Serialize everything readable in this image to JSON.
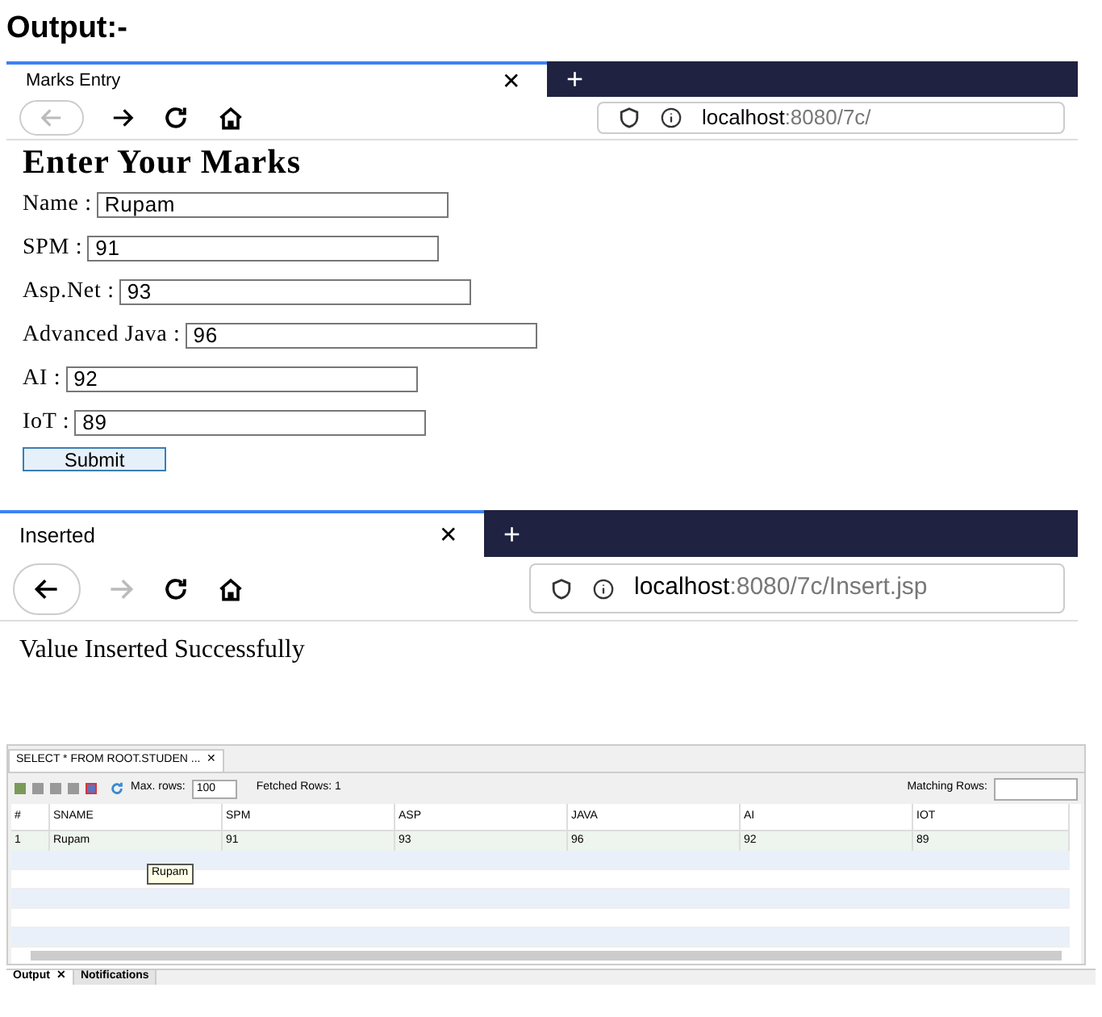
{
  "heading": "Output:-",
  "browser_1": {
    "tab": {
      "title": "Marks Entry",
      "close": "✕",
      "new_tab": "+"
    },
    "back_enabled": false,
    "forward_enabled": true,
    "url": {
      "host": "localhost",
      "path": ":8080/7c/"
    },
    "page": {
      "title": "Enter Your Marks",
      "fields": [
        {
          "label": "Name :",
          "value": "Rupam"
        },
        {
          "label": "SPM :",
          "value": "91"
        },
        {
          "label": "Asp.Net :",
          "value": "93"
        },
        {
          "label": "Advanced Java :",
          "value": "96"
        },
        {
          "label": "AI :",
          "value": "92"
        },
        {
          "label": "IoT :",
          "value": "89"
        }
      ],
      "submit": "Submit"
    }
  },
  "browser_2": {
    "tab": {
      "title": "Inserted",
      "close": "✕",
      "new_tab": "+"
    },
    "back_enabled": true,
    "forward_enabled": false,
    "url": {
      "host": "localhost",
      "path": ":8080/7c/Insert.jsp"
    },
    "page": {
      "message": "Value Inserted Successfully"
    }
  },
  "query_results": {
    "tab": {
      "title": "SELECT * FROM ROOT.STUDEN ...",
      "close": "✕"
    },
    "toolbar": {
      "max_rows_label": "Max. rows:",
      "max_rows": "100",
      "fetched_rows": "Fetched Rows: 1",
      "matching_rows_label": "Matching Rows:"
    },
    "table": {
      "columns": [
        "#",
        "SNAME",
        "SPM",
        "ASP",
        "JAVA",
        "AI",
        "IOT"
      ],
      "rows": [
        [
          "1",
          "Rupam",
          "91",
          "93",
          "96",
          "92",
          "89"
        ]
      ]
    },
    "tooltip": "Rupam",
    "bottom_tabs": [
      {
        "label": "Output",
        "selected": true,
        "close": "✕"
      },
      {
        "label": "Notifications",
        "selected": false
      }
    ]
  }
}
